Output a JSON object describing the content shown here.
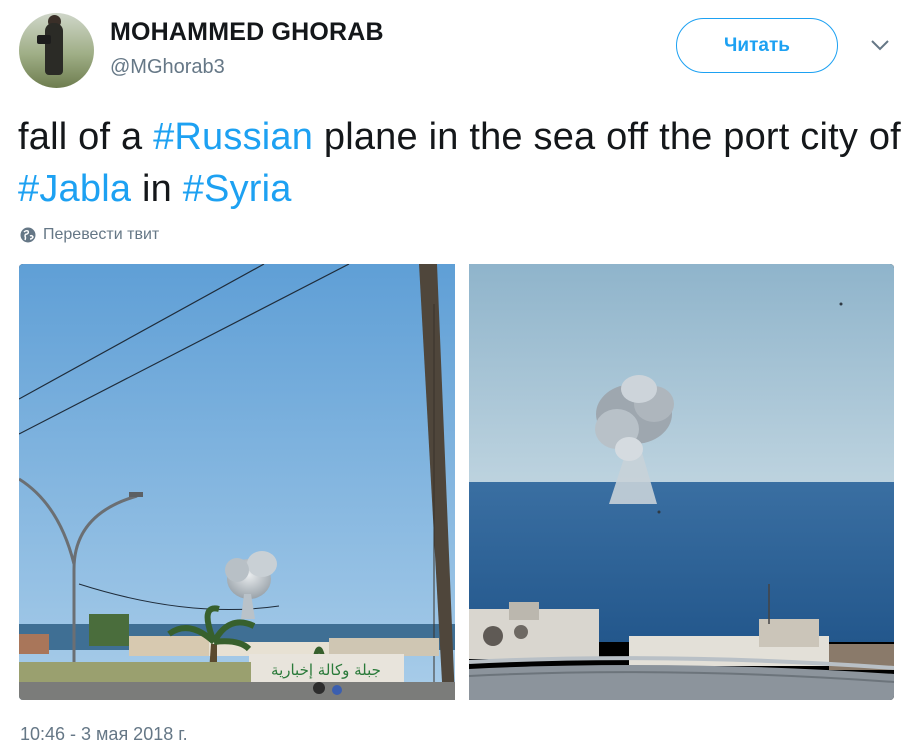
{
  "author": {
    "name": "MOHAMMED GHORAB",
    "handle": "@MGhorab3"
  },
  "follow_button": {
    "label": "Читать"
  },
  "menu": {
    "icon": "chevron-down-icon"
  },
  "tweet": {
    "segments": [
      {
        "text": "fall of a ",
        "hashtag": false
      },
      {
        "text": "#Russian",
        "hashtag": true
      },
      {
        "text": " plane in the sea off the port city of ",
        "hashtag": false
      },
      {
        "text": "#Jabla",
        "hashtag": false,
        "is_tag": true
      },
      {
        "text": " in ",
        "hashtag": false
      },
      {
        "text": "#Syria",
        "hashtag": true
      }
    ]
  },
  "translate": {
    "label": "Перевести твит",
    "icon": "globe-icon"
  },
  "media": {
    "photos": [
      {
        "name": "photo-left",
        "caption_sign": "جبلة وكالة إخبارية"
      },
      {
        "name": "photo-right"
      }
    ]
  },
  "timestamp": "10:46 - 3 мая 2018 г.",
  "colors": {
    "accent": "#1da1f2",
    "text": "#14171a",
    "secondary": "#657786"
  }
}
